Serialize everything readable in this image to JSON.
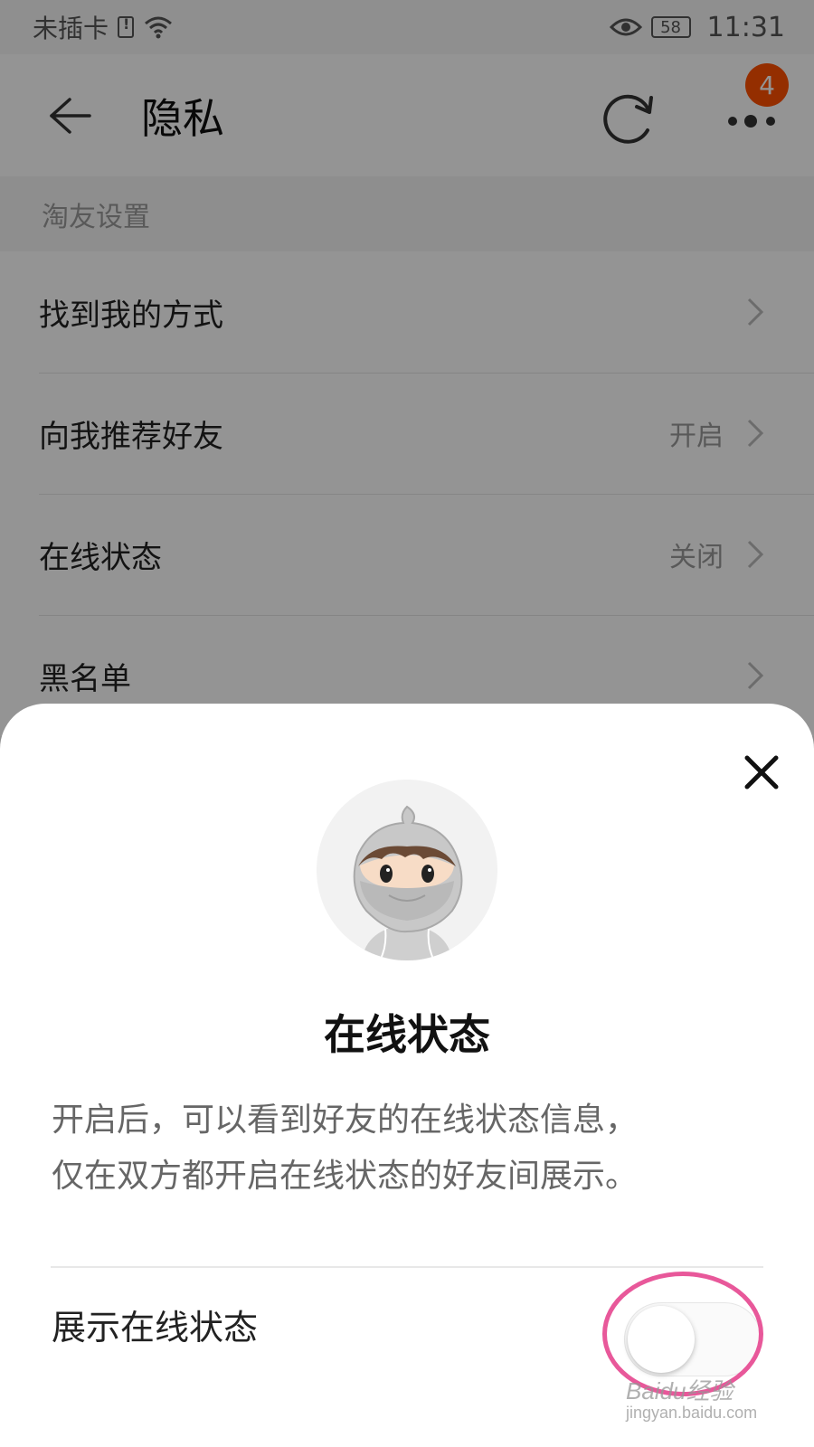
{
  "status_bar": {
    "carrier": "未插卡",
    "battery": "58",
    "time": "11:31",
    "icons": [
      "sim-alert-icon",
      "wifi-icon",
      "eye-icon",
      "battery-icon"
    ]
  },
  "app_bar": {
    "title": "隐私",
    "more_badge": "4",
    "icons": [
      "back-arrow-icon",
      "refresh-icon",
      "more-icon"
    ]
  },
  "section": {
    "header": "淘友设置"
  },
  "settings": [
    {
      "label": "找到我的方式",
      "value": ""
    },
    {
      "label": "向我推荐好友",
      "value": "开启"
    },
    {
      "label": "在线状态",
      "value": "关闭"
    },
    {
      "label": "黑名单",
      "value": ""
    }
  ],
  "sheet": {
    "title": "在线状态",
    "description_line1": "开启后，可以看到好友的在线状态信息，",
    "description_line2": "仅在双方都开启在线状态的好友间展示。",
    "toggle_label": "展示在线状态",
    "toggle_on": false
  },
  "watermark": {
    "brand": "Baidu经验",
    "url": "jingyan.baidu.com"
  },
  "colors": {
    "accent": "#ff5000",
    "highlight": "#e8589a"
  }
}
